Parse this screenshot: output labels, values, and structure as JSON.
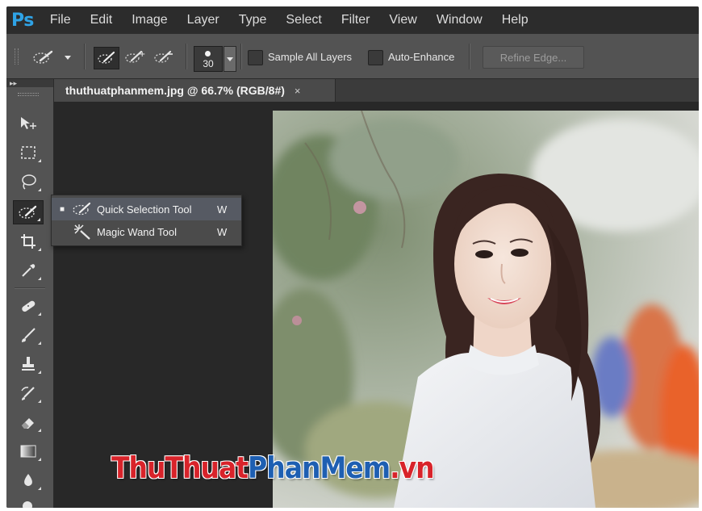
{
  "app": {
    "logo": "Ps"
  },
  "menu": [
    "File",
    "Edit",
    "Image",
    "Layer",
    "Type",
    "Select",
    "Filter",
    "View",
    "Window",
    "Help"
  ],
  "options_bar": {
    "brush_size": "30",
    "sample_all_layers_label": "Sample All Layers",
    "sample_all_layers_checked": false,
    "auto_enhance_label": "Auto-Enhance",
    "auto_enhance_checked": false,
    "refine_edge_label": "Refine Edge..."
  },
  "toolbar": {
    "collapse_glyph": "▸▸",
    "tools": [
      "move-tool",
      "marquee-tool",
      "lasso-tool",
      "quick-selection-tool",
      "crop-tool",
      "eyedropper-tool",
      "spot-healing-brush-tool",
      "brush-tool",
      "clone-stamp-tool",
      "history-brush-tool",
      "eraser-tool",
      "gradient-tool",
      "blur-tool",
      "dodge-tool"
    ],
    "active_tool": "quick-selection-tool"
  },
  "document": {
    "tab_title": "thuthuatphanmem.jpg @ 66.7% (RGB/8#)",
    "close_glyph": "×"
  },
  "flyout": {
    "items": [
      {
        "label": "Quick Selection Tool",
        "shortcut": "W",
        "selected": true,
        "bullet": "■"
      },
      {
        "label": "Magic Wand Tool",
        "shortcut": "W",
        "selected": false,
        "bullet": ""
      }
    ]
  },
  "watermark": {
    "part1": "ThuThuat",
    "part2": "PhanMem",
    "part3": ".vn"
  },
  "colors": {
    "ps_blue": "#2fa3e6",
    "wm_red": "#d8232a",
    "wm_blue": "#1e5fb2"
  }
}
